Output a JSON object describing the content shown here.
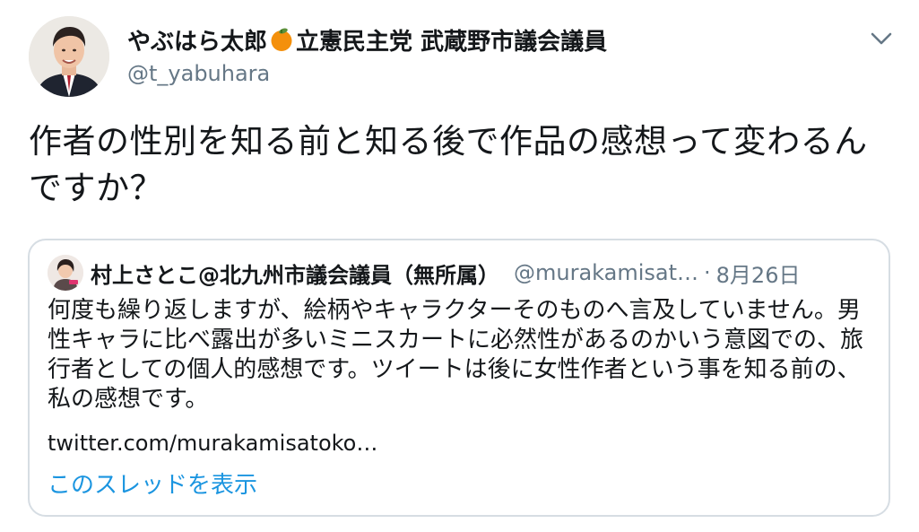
{
  "tweet": {
    "author_name": "やぶはら太郎",
    "author_affiliation": "立憲民主党 武蔵野市議会議員",
    "author_emoji": "orange-icon",
    "handle": "@t_yabuhara",
    "text": "作者の性別を知る前と知る後で作品の感想って変わるんですか？"
  },
  "quoted": {
    "name": "村上さとこ@北九州市議会議員（無所属）",
    "handle": "@murakamisat…",
    "separator": "·",
    "date": "8月26日",
    "text": "何度も繰り返しますが、絵柄やキャラクターそのものへ言及していません。男性キャラに比べ露出が多いミニスカートに必然性があるのかいう意図での、旅行者としての個人的感想です。ツイートは後に女性作者という事を知る前の、私の感想です。",
    "link": "twitter.com/murakamisatoko…",
    "show_thread": "このスレッドを表示"
  },
  "colors": {
    "text": "#14171a",
    "secondary": "#657786",
    "link": "#1b95e0",
    "border": "#d6dde3"
  }
}
